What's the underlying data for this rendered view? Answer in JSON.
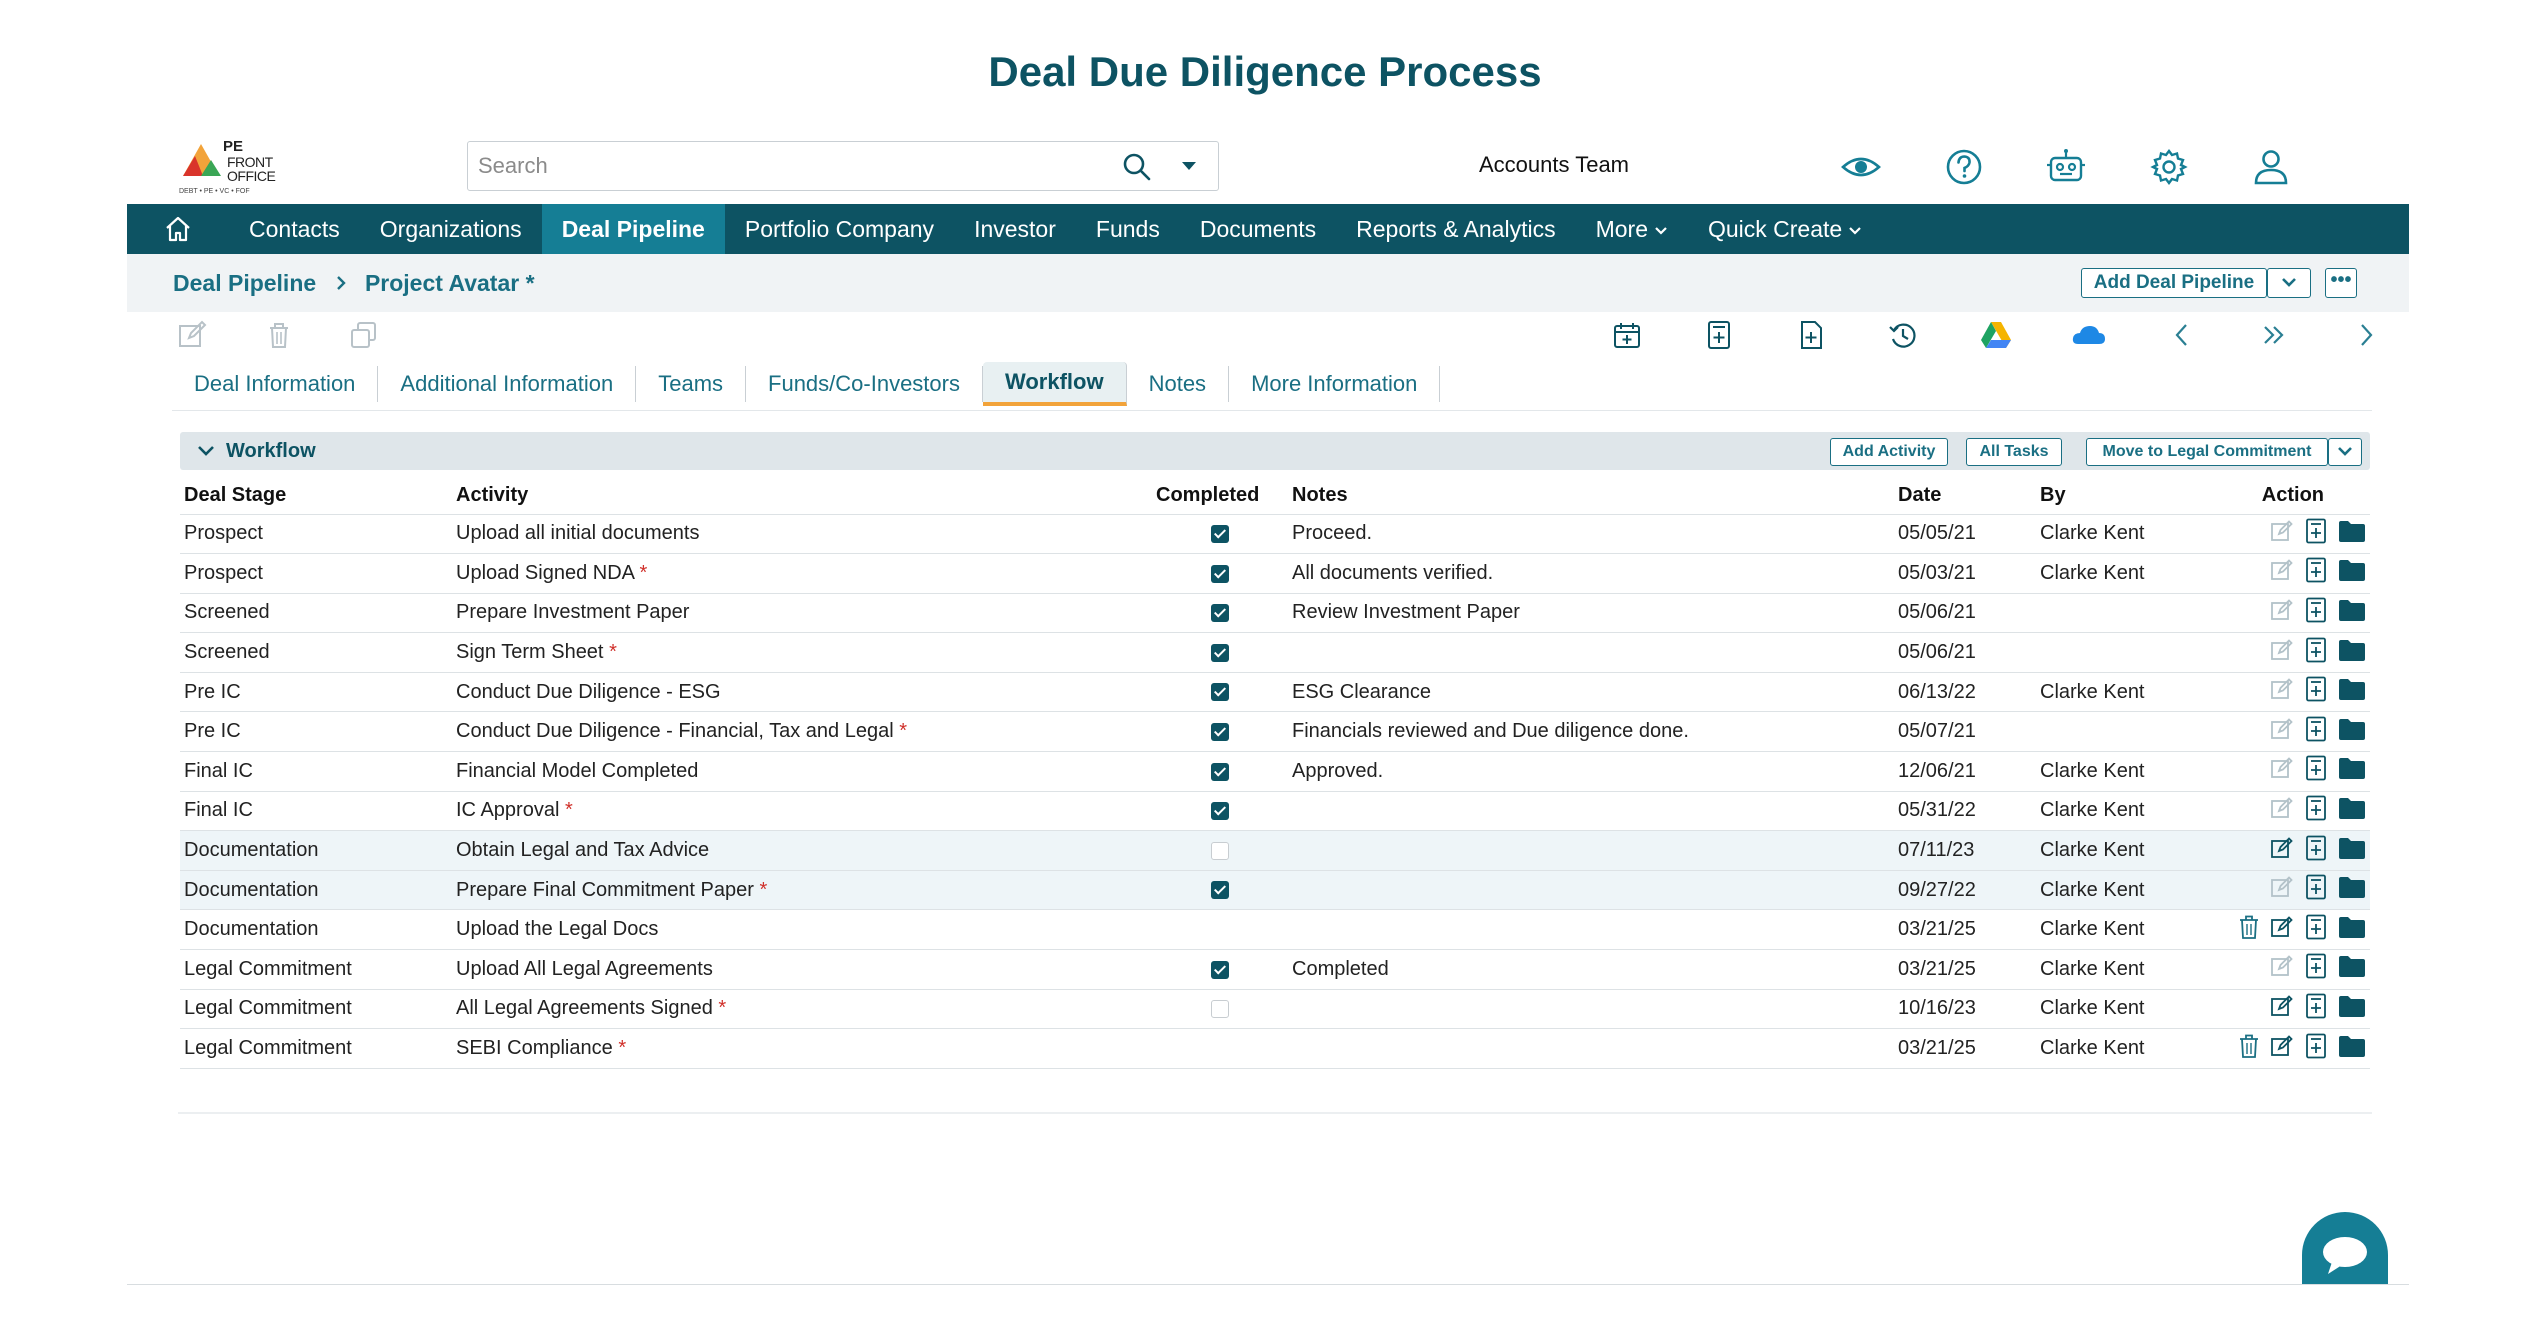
{
  "page_title": "Deal Due Diligence Process",
  "logo": {
    "line1": "PE",
    "line2": "FRONT",
    "line3": "OFFICE",
    "tagline": "DEBT • PE • VC • FOF"
  },
  "search": {
    "placeholder": "Search",
    "value": ""
  },
  "team": "Accounts Team",
  "top_icons": [
    "eye-icon",
    "help-icon",
    "robot-icon",
    "gear-icon",
    "user-icon"
  ],
  "nav": {
    "items": [
      "Contacts",
      "Organizations",
      "Deal Pipeline",
      "Portfolio Company",
      "Investor",
      "Funds",
      "Documents",
      "Reports & Analytics",
      "More",
      "Quick Create"
    ],
    "active": "Deal Pipeline"
  },
  "breadcrumb": {
    "root": "Deal Pipeline",
    "current": "Project Avatar *"
  },
  "add_deal_label": "Add Deal Pipeline",
  "more_label": "•••",
  "tabs": [
    "Deal Information",
    "Additional Information",
    "Teams",
    "Funds/Co-Investors",
    "Workflow",
    "Notes",
    "More Information"
  ],
  "active_tab": "Workflow",
  "workflow": {
    "title": "Workflow",
    "buttons": {
      "add_activity": "Add Activity",
      "all_tasks": "All Tasks",
      "move": "Move to Legal Commitment"
    },
    "headers": {
      "stage": "Deal Stage",
      "activity": "Activity",
      "completed": "Completed",
      "notes": "Notes",
      "date": "Date",
      "by": "By",
      "action": "Action"
    },
    "rows": [
      {
        "stage": "Prospect",
        "activity": "Upload all initial documents",
        "required": false,
        "completed": true,
        "notes": "Proceed.",
        "date": "05/05/21",
        "by": "Clarke Kent",
        "delete": false
      },
      {
        "stage": "Prospect",
        "activity": "Upload Signed NDA",
        "required": true,
        "completed": true,
        "notes": "All documents verified.",
        "date": "05/03/21",
        "by": "Clarke Kent",
        "delete": false
      },
      {
        "stage": "Screened",
        "activity": "Prepare Investment Paper",
        "required": false,
        "completed": true,
        "notes": "Review Investment Paper",
        "date": "05/06/21",
        "by": "",
        "delete": false
      },
      {
        "stage": "Screened",
        "activity": "Sign Term Sheet",
        "required": true,
        "completed": true,
        "notes": "",
        "date": "05/06/21",
        "by": "",
        "delete": false
      },
      {
        "stage": "Pre IC",
        "activity": "Conduct Due Diligence - ESG",
        "required": false,
        "completed": true,
        "notes": "ESG Clearance",
        "date": "06/13/22",
        "by": "Clarke Kent",
        "delete": false
      },
      {
        "stage": "Pre IC",
        "activity": "Conduct Due Diligence - Financial, Tax and Legal",
        "required": true,
        "completed": true,
        "notes": "Financials reviewed and Due diligence done.",
        "date": "05/07/21",
        "by": "",
        "delete": false
      },
      {
        "stage": "Final IC",
        "activity": "Financial Model Completed",
        "required": false,
        "completed": true,
        "notes": "Approved.",
        "date": "12/06/21",
        "by": "Clarke Kent",
        "delete": false
      },
      {
        "stage": "Final IC",
        "activity": "IC Approval",
        "required": true,
        "completed": true,
        "notes": "",
        "date": "05/31/22",
        "by": "Clarke Kent",
        "delete": false
      },
      {
        "stage": "Documentation",
        "activity": "Obtain Legal and Tax Advice",
        "required": false,
        "completed": false,
        "notes": "",
        "date": "07/11/23",
        "by": "Clarke Kent",
        "delete": false
      },
      {
        "stage": "Documentation",
        "activity": "Prepare Final Commitment Paper",
        "required": true,
        "completed": true,
        "notes": "",
        "date": "09/27/22",
        "by": "Clarke Kent",
        "delete": false
      },
      {
        "stage": "Documentation",
        "activity": "Upload the Legal Docs",
        "required": false,
        "completed": null,
        "notes": "",
        "date": "03/21/25",
        "by": "Clarke Kent",
        "delete": true
      },
      {
        "stage": "Legal Commitment",
        "activity": "Upload All Legal Agreements",
        "required": false,
        "completed": true,
        "notes": "Completed",
        "date": "03/21/25",
        "by": "Clarke Kent",
        "delete": false
      },
      {
        "stage": "Legal Commitment",
        "activity": "All Legal Agreements Signed",
        "required": true,
        "completed": false,
        "notes": "",
        "date": "10/16/23",
        "by": "Clarke Kent",
        "delete": false
      },
      {
        "stage": "Legal Commitment",
        "activity": "SEBI Compliance",
        "required": true,
        "completed": null,
        "notes": "",
        "date": "03/21/25",
        "by": "Clarke Kent",
        "delete": true
      }
    ]
  },
  "colors": {
    "brand": "#0d5363",
    "accent": "#157e95",
    "tab_underline": "#f2a33a",
    "required": "#d0302a"
  }
}
